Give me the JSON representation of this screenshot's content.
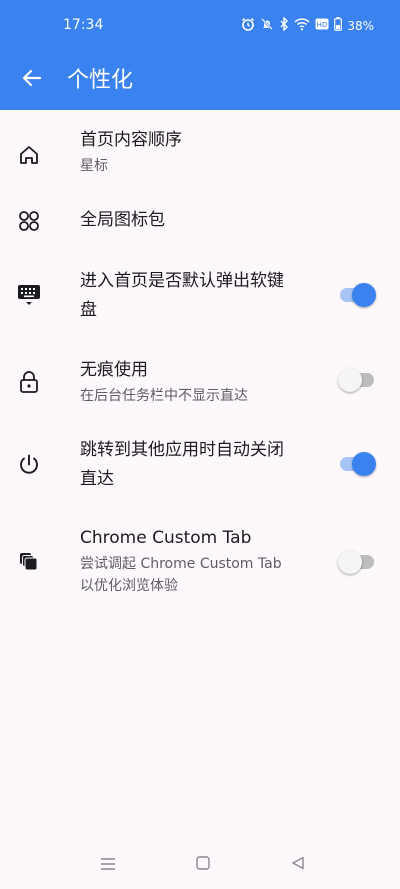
{
  "status_bar": {
    "time": "17:34",
    "battery": "38%",
    "icons": [
      "alarm-icon",
      "mute-icon",
      "bluetooth-icon",
      "wifi-icon",
      "hd-icon",
      "battery-icon"
    ]
  },
  "app_bar": {
    "title": "个性化",
    "back_icon": "arrow-back-icon"
  },
  "settings": [
    {
      "icon": "home-icon",
      "title": "首页内容顺序",
      "subtitle": "星标"
    },
    {
      "icon": "icon-pack-icon",
      "title": "全局图标包"
    },
    {
      "icon": "keyboard-icon",
      "title": "进入首页是否默认弹出软键",
      "title_line2": "盘",
      "toggle": true
    },
    {
      "icon": "lock-icon",
      "title": "无痕使用",
      "subtitle": "在后台任务栏中不显示直达",
      "toggle": false
    },
    {
      "icon": "power-icon",
      "title": "跳转到其他应用时自动关闭",
      "title_line2": "直达",
      "toggle": true
    },
    {
      "icon": "tabs-icon",
      "title": "Chrome Custom Tab",
      "subtitle": "尝试调起 Chrome Custom Tab",
      "subtitle_line2": "以优化浏览体验",
      "toggle": false
    }
  ],
  "nav_bar": {
    "icons": [
      "menu-icon",
      "home-square-icon",
      "back-triangle-icon"
    ]
  },
  "colors": {
    "accent": "#3a82ef",
    "background": "#fdf8fb"
  }
}
